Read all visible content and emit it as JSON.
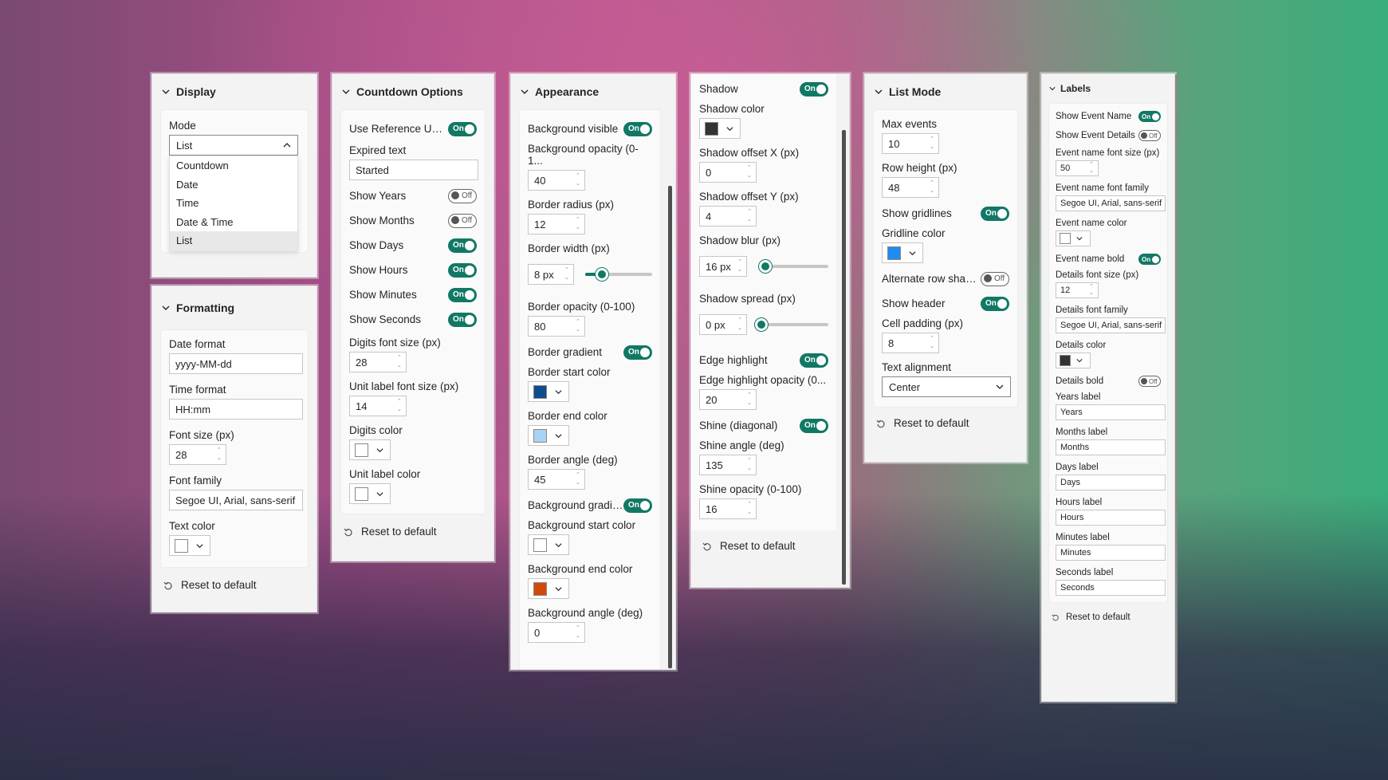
{
  "display": {
    "title": "Display",
    "mode_label": "Mode",
    "mode_value": "List",
    "mode_options": [
      "Countdown",
      "Date",
      "Time",
      "Date & Time",
      "List"
    ]
  },
  "formatting": {
    "title": "Formatting",
    "date_format_label": "Date format",
    "date_format_value": "yyyy-MM-dd",
    "time_format_label": "Time format",
    "time_format_value": "HH:mm",
    "font_size_label": "Font size (px)",
    "font_size_value": "28",
    "font_family_label": "Font family",
    "font_family_value": "Segoe UI, Arial, sans-serif",
    "text_color_label": "Text color",
    "text_color": "#ffffff",
    "reset": "Reset to default"
  },
  "countdown": {
    "title": "Countdown Options",
    "use_ref_label": "Use Reference UTC ...",
    "expired_label": "Expired text",
    "expired_value": "Started",
    "toggles": [
      {
        "label": "Show Years",
        "state": "Off"
      },
      {
        "label": "Show Months",
        "state": "Off"
      },
      {
        "label": "Show Days",
        "state": "On"
      },
      {
        "label": "Show Hours",
        "state": "On"
      },
      {
        "label": "Show Minutes",
        "state": "On"
      },
      {
        "label": "Show Seconds",
        "state": "On"
      }
    ],
    "digits_font_label": "Digits font size (px)",
    "digits_font_value": "28",
    "unit_font_label": "Unit label font size (px)",
    "unit_font_value": "14",
    "digits_color_label": "Digits color",
    "unit_color_label": "Unit label color",
    "reset": "Reset to default"
  },
  "appearance": {
    "title": "Appearance",
    "bg_visible_label": "Background visible",
    "bg_opacity_label": "Background opacity (0-1...",
    "bg_opacity_value": "40",
    "border_radius_label": "Border radius (px)",
    "border_radius_value": "12",
    "border_width_label": "Border width (px)",
    "border_width_value": "8 px",
    "border_width_level": 0.25,
    "border_opacity_label": "Border opacity (0-100)",
    "border_opacity_value": "80",
    "border_gradient_label": "Border gradient",
    "border_start_label": "Border start color",
    "border_start_color": "#0f4c8a",
    "border_end_label": "Border end color",
    "border_end_color": "#a9d3f5",
    "border_angle_label": "Border angle (deg)",
    "border_angle_value": "45",
    "bg_gradient_label": "Background gradient",
    "bg_start_label": "Background start color",
    "bg_start_color": "#ffffff",
    "bg_end_label": "Background end color",
    "bg_end_color": "#d24a0a",
    "bg_angle_label": "Background angle (deg)",
    "bg_angle_value": "0"
  },
  "shadow": {
    "shadow_label": "Shadow",
    "shadow_color_label": "Shadow color",
    "shadow_color": "#333333",
    "offset_x_label": "Shadow offset X (px)",
    "offset_x_value": "0",
    "offset_y_label": "Shadow offset Y (px)",
    "offset_y_value": "4",
    "blur_label": "Shadow blur (px)",
    "blur_value": "16 px",
    "blur_level": 0.1,
    "spread_label": "Shadow spread (px)",
    "spread_value": "0 px",
    "spread_level": 0.0,
    "edge_label": "Edge highlight",
    "edge_opacity_label": "Edge highlight opacity (0...",
    "edge_opacity_value": "20",
    "shine_label": "Shine (diagonal)",
    "shine_angle_label": "Shine angle (deg)",
    "shine_angle_value": "135",
    "shine_opacity_label": "Shine opacity (0-100)",
    "shine_opacity_value": "16",
    "reset": "Reset to default"
  },
  "listmode": {
    "title": "List Mode",
    "max_events_label": "Max events",
    "max_events_value": "10",
    "row_height_label": "Row height (px)",
    "row_height_value": "48",
    "gridlines_label": "Show gridlines",
    "gridline_color_label": "Gridline color",
    "gridline_color": "#1e8cf0",
    "alt_row_label": "Alternate row shadi...",
    "show_header_label": "Show header",
    "cell_padding_label": "Cell padding (px)",
    "cell_padding_value": "8",
    "text_align_label": "Text alignment",
    "text_align_value": "Center",
    "reset": "Reset to default"
  },
  "labels": {
    "title": "Labels",
    "show_event_name_label": "Show Event Name",
    "show_event_details_label": "Show Event Details",
    "event_font_size_label": "Event name font size (px)",
    "event_font_size_value": "50",
    "event_font_family_label": "Event name font family",
    "event_font_family_value": "Segoe UI, Arial, sans-serif",
    "event_color_label": "Event name color",
    "event_color": "#ffffff",
    "event_bold_label": "Event name bold",
    "details_font_size_label": "Details font size (px)",
    "details_font_size_value": "12",
    "details_font_family_label": "Details font family",
    "details_font_family_value": "Segoe UI, Arial, sans-serif",
    "details_color_label": "Details color",
    "details_color": "#333333",
    "details_bold_label": "Details bold",
    "years_label": "Years label",
    "years_value": "Years",
    "months_label": "Months label",
    "months_value": "Months",
    "days_label": "Days label",
    "days_value": "Days",
    "hours_label": "Hours label",
    "hours_value": "Hours",
    "minutes_label": "Minutes label",
    "minutes_value": "Minutes",
    "seconds_label": "Seconds label",
    "seconds_value": "Seconds",
    "reset": "Reset to default"
  },
  "toggle_on": "On",
  "toggle_off": "Off"
}
